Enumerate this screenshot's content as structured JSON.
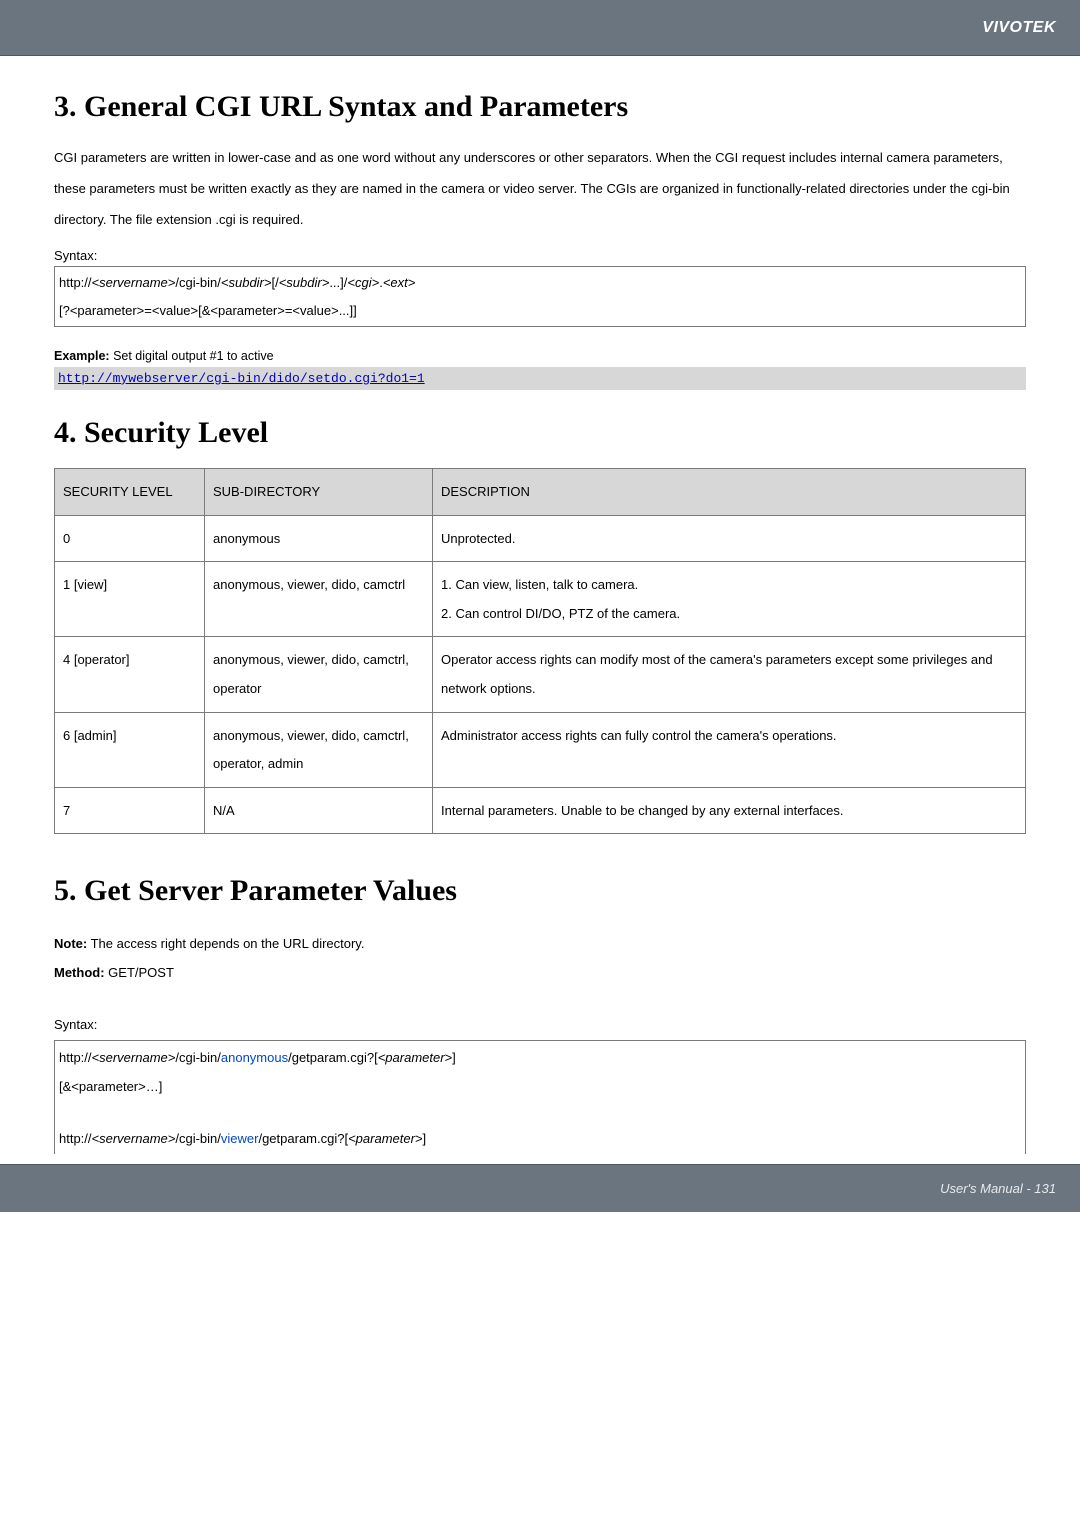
{
  "header": {
    "brand": "VIVOTEK"
  },
  "sec3": {
    "title": "3. General CGI URL Syntax and Parameters",
    "para": "CGI parameters are written in lower-case and as one word without any underscores or other separators. When the CGI request includes internal camera parameters, these parameters must be written exactly as they are named in the camera or video server. The CGIs are organized in functionally-related directories under the cgi-bin directory. The file extension .cgi is required.",
    "syntax_label": "Syntax:",
    "syntax": {
      "l1a": "http://",
      "l1b": "<servername>",
      "l1c": "/cgi-bin/",
      "l1d": "<subdir>",
      "l1e": "[/",
      "l1f": "<subdir>",
      "l1g": "...]/",
      "l1h": "<cgi>",
      "l1i": ".",
      "l1j": "<ext>",
      "l2": "[?<parameter>=<value>[&<parameter>=<value>...]]"
    },
    "example_label": "Example:",
    "example_text": " Set digital output #1 to active",
    "example_url": "http://mywebserver/cgi-bin/dido/setdo.cgi?do1=1"
  },
  "sec4": {
    "title": "4. Security Level",
    "head": {
      "c1": "SECURITY LEVEL",
      "c2": "SUB-DIRECTORY",
      "c3": "DESCRIPTION"
    },
    "rows": [
      {
        "c1": "0",
        "c2": "anonymous",
        "c3": "Unprotected."
      },
      {
        "c1": "1 [view]",
        "c2": "anonymous, viewer, dido, camctrl",
        "c3": "1. Can view, listen, talk to camera.\n2. Can control DI/DO, PTZ of the camera."
      },
      {
        "c1": "4 [operator]",
        "c2": "anonymous, viewer, dido, camctrl, operator",
        "c3": "Operator access rights can modify most of the camera's parameters except some privileges and network options."
      },
      {
        "c1": "6 [admin]",
        "c2": "anonymous, viewer, dido, camctrl, operator, admin",
        "c3": "Administrator access rights can fully control the camera's operations."
      },
      {
        "c1": "7",
        "c2": "N/A",
        "c3": "Internal parameters. Unable to be changed by any external interfaces."
      }
    ]
  },
  "sec5": {
    "title": "5. Get Server Parameter Values",
    "note_label": "Note:",
    "note_text": " The access right depends on the URL directory.",
    "method_label": "Method:",
    "method_text": " GET/POST",
    "syntax_label": "Syntax:",
    "box": {
      "l1a": "http://",
      "l1b": "<servername>",
      "l1c": "/cgi-bin/",
      "l1d": "anonymous",
      "l1e": "/getparam.cgi?[",
      "l1f": "<parameter>",
      "l1g": "]",
      "l2": "[&<parameter>…]",
      "l3a": "http://",
      "l3b": "<servername>",
      "l3c": "/cgi-bin/",
      "l3d": "viewer",
      "l3e": "/getparam.cgi?[",
      "l3f": "<parameter>",
      "l3g": "]"
    }
  },
  "footer": {
    "text": "User's Manual - 131"
  }
}
